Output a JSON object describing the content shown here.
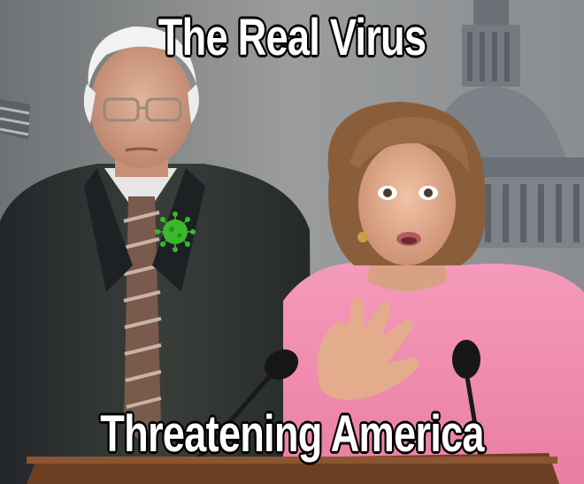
{
  "meme": {
    "top_caption": "The Real Virus",
    "bottom_caption": "Threatening America",
    "colors": {
      "caption_text": "#ffffff",
      "caption_outline": "#000000",
      "background_wall": "#8e9091",
      "capitol_dome": "#6d7278",
      "left_suit": "#2b2f2c",
      "right_top": "#ef8fb0",
      "podium": "#6b3f22",
      "virus_badge": "#3bb82c"
    },
    "icons": [
      "virus-icon",
      "microphone-icon",
      "capitol-dome-icon",
      "flag-icon"
    ]
  }
}
